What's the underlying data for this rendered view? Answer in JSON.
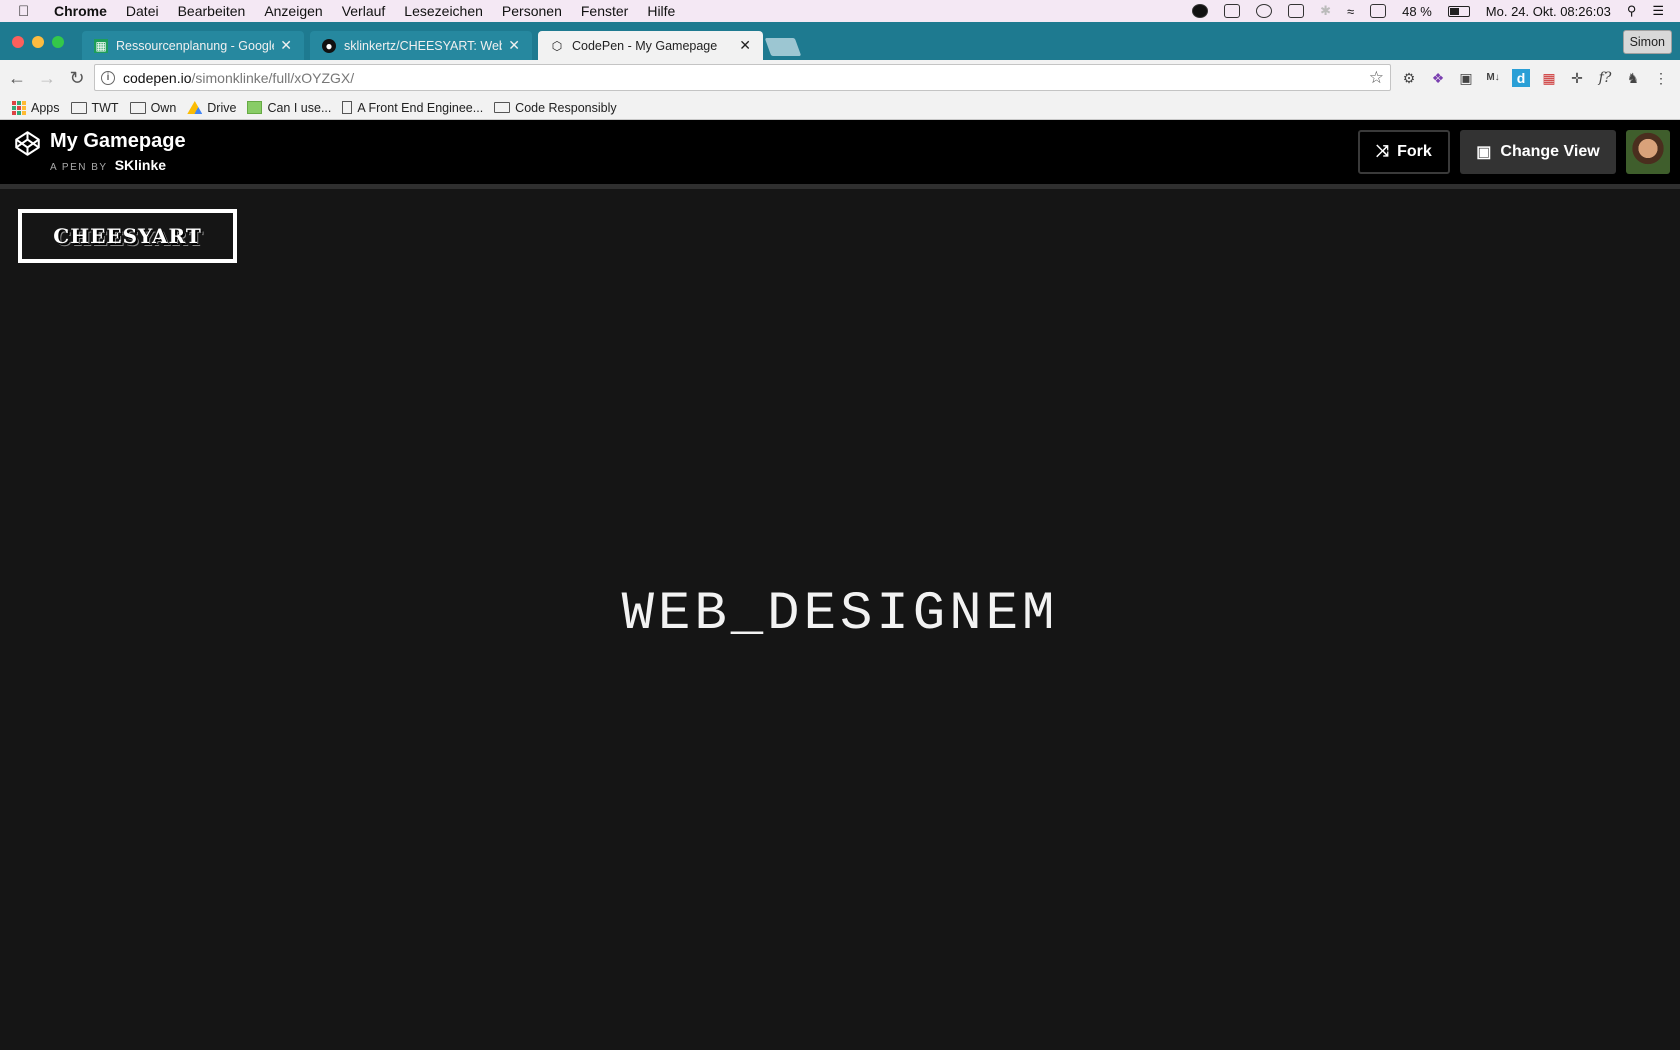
{
  "menubar": {
    "app_name": "Chrome",
    "items": [
      "Datei",
      "Bearbeiten",
      "Anzeigen",
      "Verlauf",
      "Lesezeichen",
      "Personen",
      "Fenster",
      "Hilfe"
    ],
    "battery_percent": "48 %",
    "battery_level": 0.48,
    "clock": "Mo. 24. Okt. 08:26:03"
  },
  "tabs": [
    {
      "title": "Ressourcenplanung - Google T",
      "icon": "sheets-icon"
    },
    {
      "title": "sklinkertz/CHEESYART: Websi",
      "icon": "github-icon"
    },
    {
      "title": "CodePen - My Gamepage",
      "icon": "codepen-icon",
      "active": true
    }
  ],
  "profile_name": "Simon",
  "toolbar": {
    "url_host": "codepen.io",
    "url_path": "/simonklinke/full/xOYZGX/"
  },
  "bookmarks": [
    {
      "label": "Apps",
      "icon": "apps-grid-icon"
    },
    {
      "label": "TWT",
      "icon": "folder-icon"
    },
    {
      "label": "Own",
      "icon": "folder-icon"
    },
    {
      "label": "Drive",
      "icon": "drive-icon"
    },
    {
      "label": "Can I use...",
      "icon": "image-icon"
    },
    {
      "label": "A Front End Enginee...",
      "icon": "page-icon"
    },
    {
      "label": "Code Responsibly",
      "icon": "code-icon"
    }
  ],
  "codepen": {
    "pen_title": "My Gamepage",
    "byline": "A PEN BY",
    "author": "SKlinke",
    "fork_label": "Fork",
    "change_view_label": "Change View"
  },
  "content": {
    "logo_text": "CHEESYART",
    "headline": "WEB_DESIGNEM"
  },
  "colors": {
    "tabstrip": "#1e7a90",
    "page_background": "#151515",
    "codepen_header": "#000000"
  }
}
